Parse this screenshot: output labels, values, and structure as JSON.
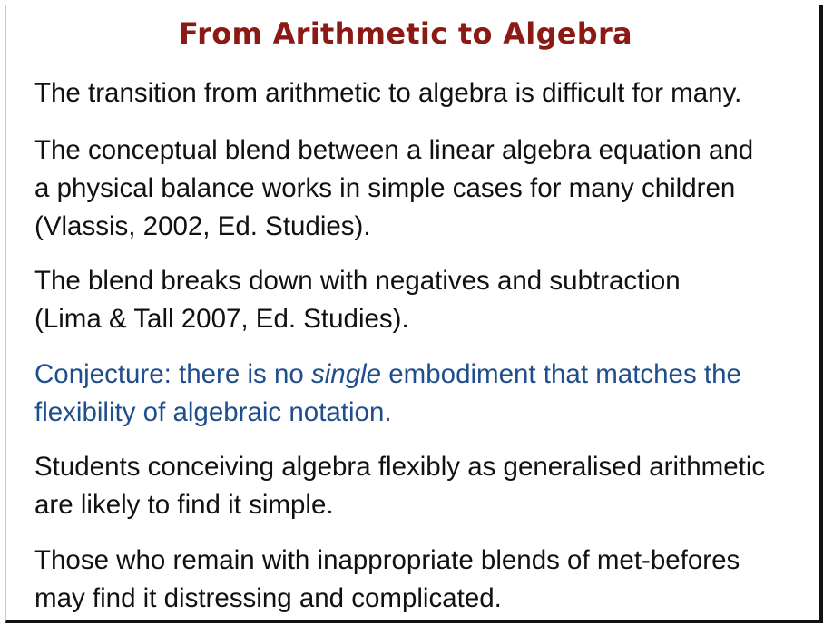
{
  "slide": {
    "title": "From Arithmetic to Algebra",
    "paragraphs": [
      {
        "lines": [
          "The transition from arithmetic to algebra is difficult for many."
        ]
      },
      {
        "lines": [
          "The conceptual blend between a linear algebra equation and",
          "a physical balance works in simple cases for many children",
          "(Vlassis, 2002, Ed. Studies)."
        ]
      },
      {
        "lines": [
          "The blend breaks down with negatives and subtraction",
          "(Lima & Tall 2007, Ed. Studies)."
        ]
      },
      {
        "line1_before": "Conjecture: there is no ",
        "line1_emphasis": "single",
        "line1_after": " embodiment that matches the",
        "line2": "flexibility of algebraic notation.",
        "color": "#1f4e8c"
      },
      {
        "lines": [
          "Students conceiving algebra flexibly as generalised arithmetic",
          "are likely to find it simple."
        ]
      },
      {
        "lines": [
          "Those who remain with inappropriate blends of met-befores",
          "may find it distressing and complicated."
        ]
      }
    ],
    "colors": {
      "title": "#8b1a14",
      "body": "#111111",
      "conjecture": "#1f4e8c",
      "border": "#111111"
    }
  }
}
